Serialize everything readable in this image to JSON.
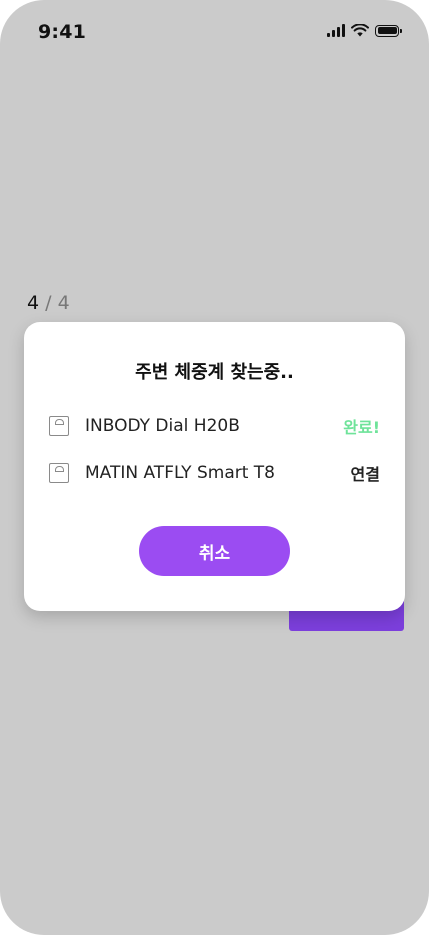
{
  "status_bar": {
    "time": "9:41",
    "icons": [
      "cellular-signal-icon",
      "wifi-icon",
      "battery-icon"
    ]
  },
  "page_counter": {
    "current": "4",
    "separator": "/",
    "total": "4"
  },
  "modal": {
    "title": "주변 체중계 찾는중..",
    "devices": [
      {
        "icon": "scale-icon",
        "name": "INBODY Dial H20B",
        "status": "완료!",
        "status_color": "#6fe39a"
      },
      {
        "icon": "scale-icon",
        "name": "MATIN ATFLY Smart T8",
        "status": "연결",
        "status_color": "#222222"
      }
    ],
    "cancel_label": "취소"
  },
  "colors": {
    "background": "#cbcbcb",
    "accent": "#9b4cf2",
    "accent_dark": "#7c3fdc",
    "success": "#6fe39a"
  }
}
